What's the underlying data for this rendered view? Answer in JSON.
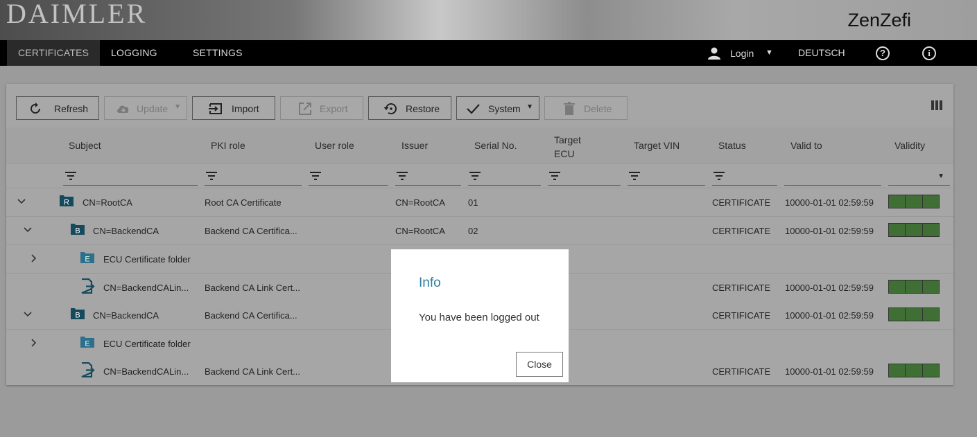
{
  "header": {
    "brand": "DAIMLER",
    "product": "ZenZefi"
  },
  "nav": {
    "tabs": [
      {
        "label": "CERTIFICATES"
      },
      {
        "label": "LOGGING"
      },
      {
        "label": "SETTINGS"
      }
    ],
    "login_label": "Login",
    "language": "DEUTSCH",
    "help_glyph": "?",
    "info_glyph": "i"
  },
  "toolbar": {
    "refresh": "Refresh",
    "update": "Update",
    "import": "Import",
    "export": "Export",
    "restore": "Restore",
    "system": "System",
    "delete": "Delete"
  },
  "table": {
    "columns": [
      "Subject",
      "PKI role",
      "User role",
      "Issuer",
      "Serial No.",
      "Target ECU",
      "Target VIN",
      "Status",
      "Valid to",
      "Validity"
    ],
    "rows": [
      {
        "subject": "CN=RootCA",
        "pki_role": "Root CA Certificate",
        "issuer": "CN=RootCA",
        "serial": "01",
        "status": "CERTIFICATE",
        "valid_to": "10000-01-01 02:59:59",
        "type_letter": "R"
      },
      {
        "subject": "CN=BackendCA",
        "pki_role": "Backend CA Certifica...",
        "issuer": "CN=RootCA",
        "serial": "02",
        "status": "CERTIFICATE",
        "valid_to": "10000-01-01 02:59:59",
        "type_letter": "B"
      },
      {
        "subject": "ECU Certificate folder",
        "type_letter": "E"
      },
      {
        "subject": "CN=BackendCALin...",
        "pki_role": "Backend CA Link Cert...",
        "status": "CERTIFICATE",
        "valid_to": "10000-01-01 02:59:59"
      },
      {
        "subject": "CN=BackendCA",
        "pki_role": "Backend CA Certifica...",
        "status": "CERTIFICATE",
        "valid_to": "10000-01-01 02:59:59",
        "type_letter": "B"
      },
      {
        "subject": "ECU Certificate folder",
        "type_letter": "E"
      },
      {
        "subject": "CN=BackendCALin...",
        "pki_role": "Backend CA Link Cert...",
        "status": "CERTIFICATE",
        "valid_to": "10000-01-01 02:59:59"
      }
    ]
  },
  "dialog": {
    "title": "Info",
    "message": "You have been logged out",
    "close_label": "Close"
  },
  "colors": {
    "accent": "#2f7fa0",
    "validity_green": "#3f6f34",
    "cert_icon": "#15495c"
  }
}
